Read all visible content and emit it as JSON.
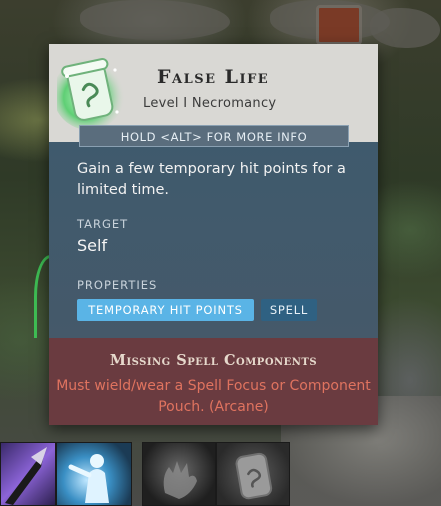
{
  "spell": {
    "icon": "spell-scroll-icon",
    "name": "False Life",
    "level_school": "Level I Necromancy",
    "hint": "HOLD <ALT> FOR MORE INFO",
    "description": "Gain a few temporary hit points for a limited time.",
    "target_label": "TARGET",
    "target_value": "Self",
    "properties_label": "PROPERTIES",
    "properties": [
      "TEMPORARY HIT POINTS",
      "SPELL"
    ]
  },
  "warning": {
    "title": "Missing Spell Components",
    "message": "Must wield/wear a Spell Focus or Component Pouch. (Arcane)"
  },
  "hotbar": {
    "slots": [
      "shadow-blade-icon",
      "glowing-figure-icon",
      "grasping-hand-icon",
      "spell-scroll-icon"
    ]
  },
  "colors": {
    "header_bg": "#d9d8d4",
    "body_bg": "#45596a",
    "footer_bg": "#6a3b40",
    "chip_primary": "#5ab4e6",
    "chip_secondary": "#2f6182",
    "warning_text": "#e0735f"
  }
}
